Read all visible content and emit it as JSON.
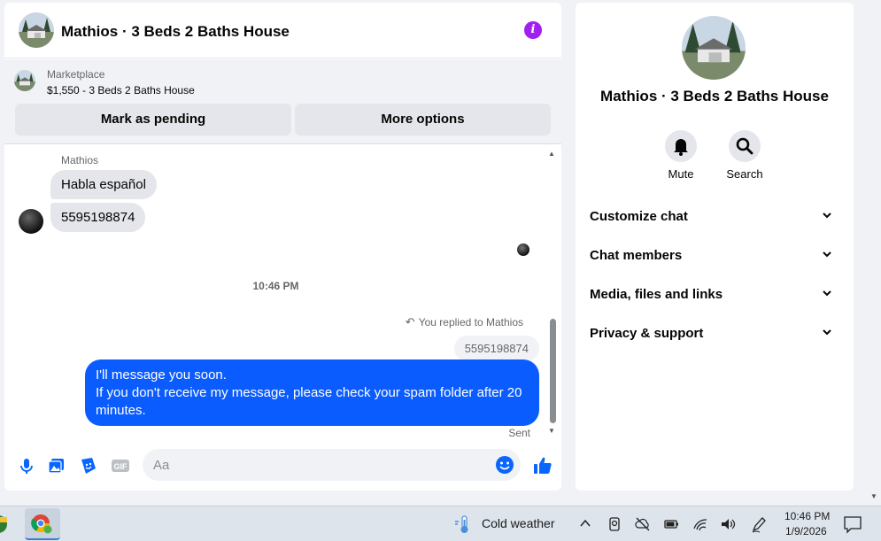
{
  "chat": {
    "title": "Mathios · 3 Beds 2 Baths House",
    "listing": {
      "source": "Marketplace",
      "price_title": "$1,550 - 3 Beds 2 Baths House",
      "pending_label": "Mark as pending",
      "options_label": "More options"
    },
    "messages": {
      "sender": "Mathios",
      "received": [
        "Habla español",
        "5595198874"
      ],
      "timestamp": "10:46 PM",
      "reply_note": "You replied to Mathios",
      "quoted": "5595198874",
      "sent_lines": [
        "I'll message you soon.",
        "If you don't receive my message, please check your spam folder after 20",
        "minutes."
      ],
      "status": "Sent"
    },
    "composer": {
      "placeholder": "Aa",
      "gif_label": "GIF"
    }
  },
  "side": {
    "name": "Mathios · 3 Beds 2 Baths House",
    "mute_label": "Mute",
    "search_label": "Search",
    "sections": [
      "Customize chat",
      "Chat members",
      "Media, files and links",
      "Privacy & support"
    ]
  },
  "taskbar": {
    "weather": "Cold weather",
    "time": "10:46 PM",
    "date": "1/9/2026"
  },
  "colors": {
    "accent": "#0a5cff",
    "info": "#a020f0",
    "icon_blue": "#0866ff"
  }
}
